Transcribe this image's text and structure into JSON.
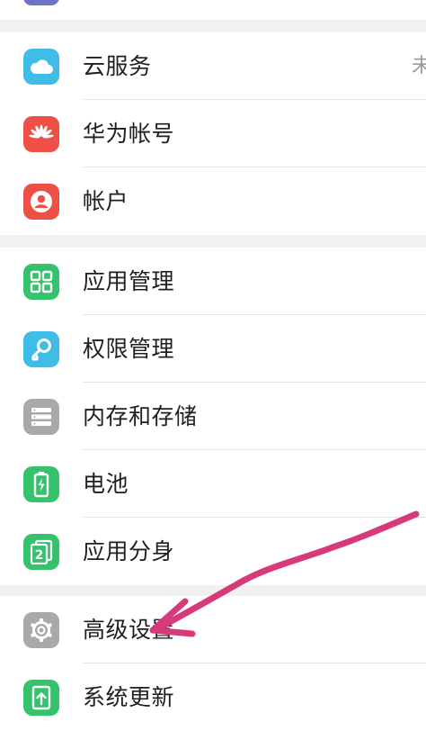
{
  "groups": [
    {
      "items": [
        {
          "label": "云服务",
          "value": "未",
          "icon": "cloud-icon",
          "color": "#3fbde6"
        },
        {
          "label": "华为帐号",
          "icon": "huawei-logo-icon",
          "color": "#ef5046"
        },
        {
          "label": "帐户",
          "icon": "user-account-icon",
          "color": "#ef5046"
        }
      ]
    },
    {
      "items": [
        {
          "label": "应用管理",
          "icon": "app-grid-icon",
          "color": "#35c26c"
        },
        {
          "label": "权限管理",
          "icon": "key-icon",
          "color": "#3fbde6"
        },
        {
          "label": "内存和存储",
          "icon": "storage-icon",
          "color": "#a9a9a9"
        },
        {
          "label": "电池",
          "icon": "battery-icon",
          "color": "#35c26c"
        },
        {
          "label": "应用分身",
          "icon": "app-twin-icon",
          "color": "#35c26c"
        }
      ]
    },
    {
      "items": [
        {
          "label": "高级设置",
          "icon": "gear-icon",
          "color": "#a9a9a9"
        },
        {
          "label": "系统更新",
          "icon": "system-update-icon",
          "color": "#35c26c"
        }
      ]
    }
  ],
  "annotation": {
    "icon": "arrow-annotation",
    "color": "#d63a7a"
  }
}
